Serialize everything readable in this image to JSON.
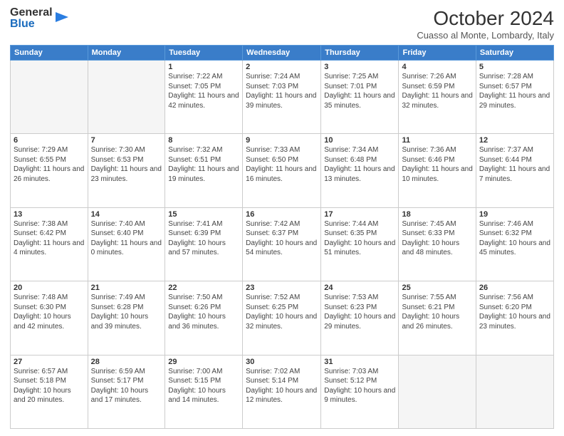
{
  "header": {
    "logo": {
      "general": "General",
      "blue": "Blue"
    },
    "title": "October 2024",
    "location": "Cuasso al Monte, Lombardy, Italy"
  },
  "calendar": {
    "days_of_week": [
      "Sunday",
      "Monday",
      "Tuesday",
      "Wednesday",
      "Thursday",
      "Friday",
      "Saturday"
    ],
    "weeks": [
      [
        {
          "day": "",
          "sunrise": "",
          "sunset": "",
          "daylight": ""
        },
        {
          "day": "",
          "sunrise": "",
          "sunset": "",
          "daylight": ""
        },
        {
          "day": "1",
          "sunrise": "Sunrise: 7:22 AM",
          "sunset": "Sunset: 7:05 PM",
          "daylight": "Daylight: 11 hours and 42 minutes."
        },
        {
          "day": "2",
          "sunrise": "Sunrise: 7:24 AM",
          "sunset": "Sunset: 7:03 PM",
          "daylight": "Daylight: 11 hours and 39 minutes."
        },
        {
          "day": "3",
          "sunrise": "Sunrise: 7:25 AM",
          "sunset": "Sunset: 7:01 PM",
          "daylight": "Daylight: 11 hours and 35 minutes."
        },
        {
          "day": "4",
          "sunrise": "Sunrise: 7:26 AM",
          "sunset": "Sunset: 6:59 PM",
          "daylight": "Daylight: 11 hours and 32 minutes."
        },
        {
          "day": "5",
          "sunrise": "Sunrise: 7:28 AM",
          "sunset": "Sunset: 6:57 PM",
          "daylight": "Daylight: 11 hours and 29 minutes."
        }
      ],
      [
        {
          "day": "6",
          "sunrise": "Sunrise: 7:29 AM",
          "sunset": "Sunset: 6:55 PM",
          "daylight": "Daylight: 11 hours and 26 minutes."
        },
        {
          "day": "7",
          "sunrise": "Sunrise: 7:30 AM",
          "sunset": "Sunset: 6:53 PM",
          "daylight": "Daylight: 11 hours and 23 minutes."
        },
        {
          "day": "8",
          "sunrise": "Sunrise: 7:32 AM",
          "sunset": "Sunset: 6:51 PM",
          "daylight": "Daylight: 11 hours and 19 minutes."
        },
        {
          "day": "9",
          "sunrise": "Sunrise: 7:33 AM",
          "sunset": "Sunset: 6:50 PM",
          "daylight": "Daylight: 11 hours and 16 minutes."
        },
        {
          "day": "10",
          "sunrise": "Sunrise: 7:34 AM",
          "sunset": "Sunset: 6:48 PM",
          "daylight": "Daylight: 11 hours and 13 minutes."
        },
        {
          "day": "11",
          "sunrise": "Sunrise: 7:36 AM",
          "sunset": "Sunset: 6:46 PM",
          "daylight": "Daylight: 11 hours and 10 minutes."
        },
        {
          "day": "12",
          "sunrise": "Sunrise: 7:37 AM",
          "sunset": "Sunset: 6:44 PM",
          "daylight": "Daylight: 11 hours and 7 minutes."
        }
      ],
      [
        {
          "day": "13",
          "sunrise": "Sunrise: 7:38 AM",
          "sunset": "Sunset: 6:42 PM",
          "daylight": "Daylight: 11 hours and 4 minutes."
        },
        {
          "day": "14",
          "sunrise": "Sunrise: 7:40 AM",
          "sunset": "Sunset: 6:40 PM",
          "daylight": "Daylight: 11 hours and 0 minutes."
        },
        {
          "day": "15",
          "sunrise": "Sunrise: 7:41 AM",
          "sunset": "Sunset: 6:39 PM",
          "daylight": "Daylight: 10 hours and 57 minutes."
        },
        {
          "day": "16",
          "sunrise": "Sunrise: 7:42 AM",
          "sunset": "Sunset: 6:37 PM",
          "daylight": "Daylight: 10 hours and 54 minutes."
        },
        {
          "day": "17",
          "sunrise": "Sunrise: 7:44 AM",
          "sunset": "Sunset: 6:35 PM",
          "daylight": "Daylight: 10 hours and 51 minutes."
        },
        {
          "day": "18",
          "sunrise": "Sunrise: 7:45 AM",
          "sunset": "Sunset: 6:33 PM",
          "daylight": "Daylight: 10 hours and 48 minutes."
        },
        {
          "day": "19",
          "sunrise": "Sunrise: 7:46 AM",
          "sunset": "Sunset: 6:32 PM",
          "daylight": "Daylight: 10 hours and 45 minutes."
        }
      ],
      [
        {
          "day": "20",
          "sunrise": "Sunrise: 7:48 AM",
          "sunset": "Sunset: 6:30 PM",
          "daylight": "Daylight: 10 hours and 42 minutes."
        },
        {
          "day": "21",
          "sunrise": "Sunrise: 7:49 AM",
          "sunset": "Sunset: 6:28 PM",
          "daylight": "Daylight: 10 hours and 39 minutes."
        },
        {
          "day": "22",
          "sunrise": "Sunrise: 7:50 AM",
          "sunset": "Sunset: 6:26 PM",
          "daylight": "Daylight: 10 hours and 36 minutes."
        },
        {
          "day": "23",
          "sunrise": "Sunrise: 7:52 AM",
          "sunset": "Sunset: 6:25 PM",
          "daylight": "Daylight: 10 hours and 32 minutes."
        },
        {
          "day": "24",
          "sunrise": "Sunrise: 7:53 AM",
          "sunset": "Sunset: 6:23 PM",
          "daylight": "Daylight: 10 hours and 29 minutes."
        },
        {
          "day": "25",
          "sunrise": "Sunrise: 7:55 AM",
          "sunset": "Sunset: 6:21 PM",
          "daylight": "Daylight: 10 hours and 26 minutes."
        },
        {
          "day": "26",
          "sunrise": "Sunrise: 7:56 AM",
          "sunset": "Sunset: 6:20 PM",
          "daylight": "Daylight: 10 hours and 23 minutes."
        }
      ],
      [
        {
          "day": "27",
          "sunrise": "Sunrise: 6:57 AM",
          "sunset": "Sunset: 5:18 PM",
          "daylight": "Daylight: 10 hours and 20 minutes."
        },
        {
          "day": "28",
          "sunrise": "Sunrise: 6:59 AM",
          "sunset": "Sunset: 5:17 PM",
          "daylight": "Daylight: 10 hours and 17 minutes."
        },
        {
          "day": "29",
          "sunrise": "Sunrise: 7:00 AM",
          "sunset": "Sunset: 5:15 PM",
          "daylight": "Daylight: 10 hours and 14 minutes."
        },
        {
          "day": "30",
          "sunrise": "Sunrise: 7:02 AM",
          "sunset": "Sunset: 5:14 PM",
          "daylight": "Daylight: 10 hours and 12 minutes."
        },
        {
          "day": "31",
          "sunrise": "Sunrise: 7:03 AM",
          "sunset": "Sunset: 5:12 PM",
          "daylight": "Daylight: 10 hours and 9 minutes."
        },
        {
          "day": "",
          "sunrise": "",
          "sunset": "",
          "daylight": ""
        },
        {
          "day": "",
          "sunrise": "",
          "sunset": "",
          "daylight": ""
        }
      ]
    ]
  }
}
